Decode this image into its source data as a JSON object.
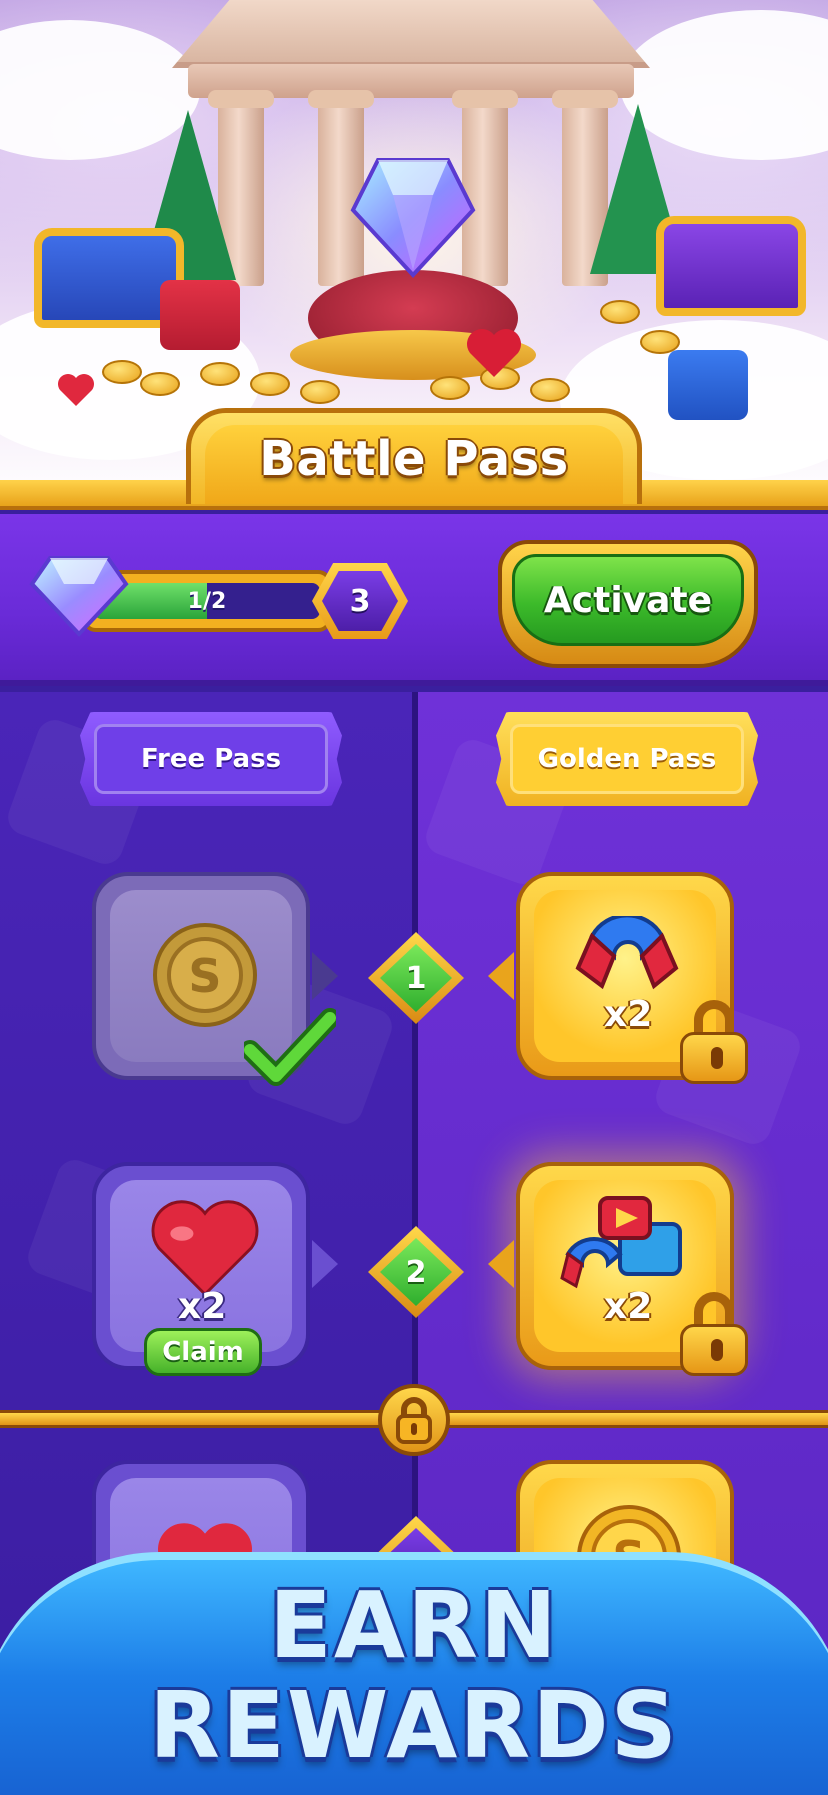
{
  "header": {
    "title": "Battle Pass"
  },
  "progress": {
    "label": "1/2",
    "fraction": 0.5,
    "level": "3"
  },
  "activate_button": {
    "label": "Activate"
  },
  "passes": {
    "free_label": "Free Pass",
    "golden_label": "Golden Pass"
  },
  "rewards": [
    {
      "step": "1",
      "free": {
        "item": "coin-icon",
        "qty": "",
        "state": "claimed"
      },
      "golden": {
        "item": "magnet-icon",
        "qty": "x2",
        "state": "locked"
      }
    },
    {
      "step": "2",
      "free": {
        "item": "heart-icon",
        "qty": "x2",
        "state": "claimable",
        "claim_label": "Claim"
      },
      "golden": {
        "item": "booster-bundle-icon",
        "qty": "x2",
        "state": "locked"
      }
    },
    {
      "step": "",
      "free": {
        "item": "heart-icon",
        "qty": "",
        "state": "partial"
      },
      "golden": {
        "item": "coin-icon",
        "qty": "",
        "state": "partial"
      }
    }
  ],
  "banner": {
    "line1": "EARN",
    "line2": "REWARDS"
  },
  "colors": {
    "accent_gold": "#f2b625",
    "purple": "#6a2bd8",
    "green": "#3cba2a",
    "blue_banner": "#1d7ee8"
  }
}
